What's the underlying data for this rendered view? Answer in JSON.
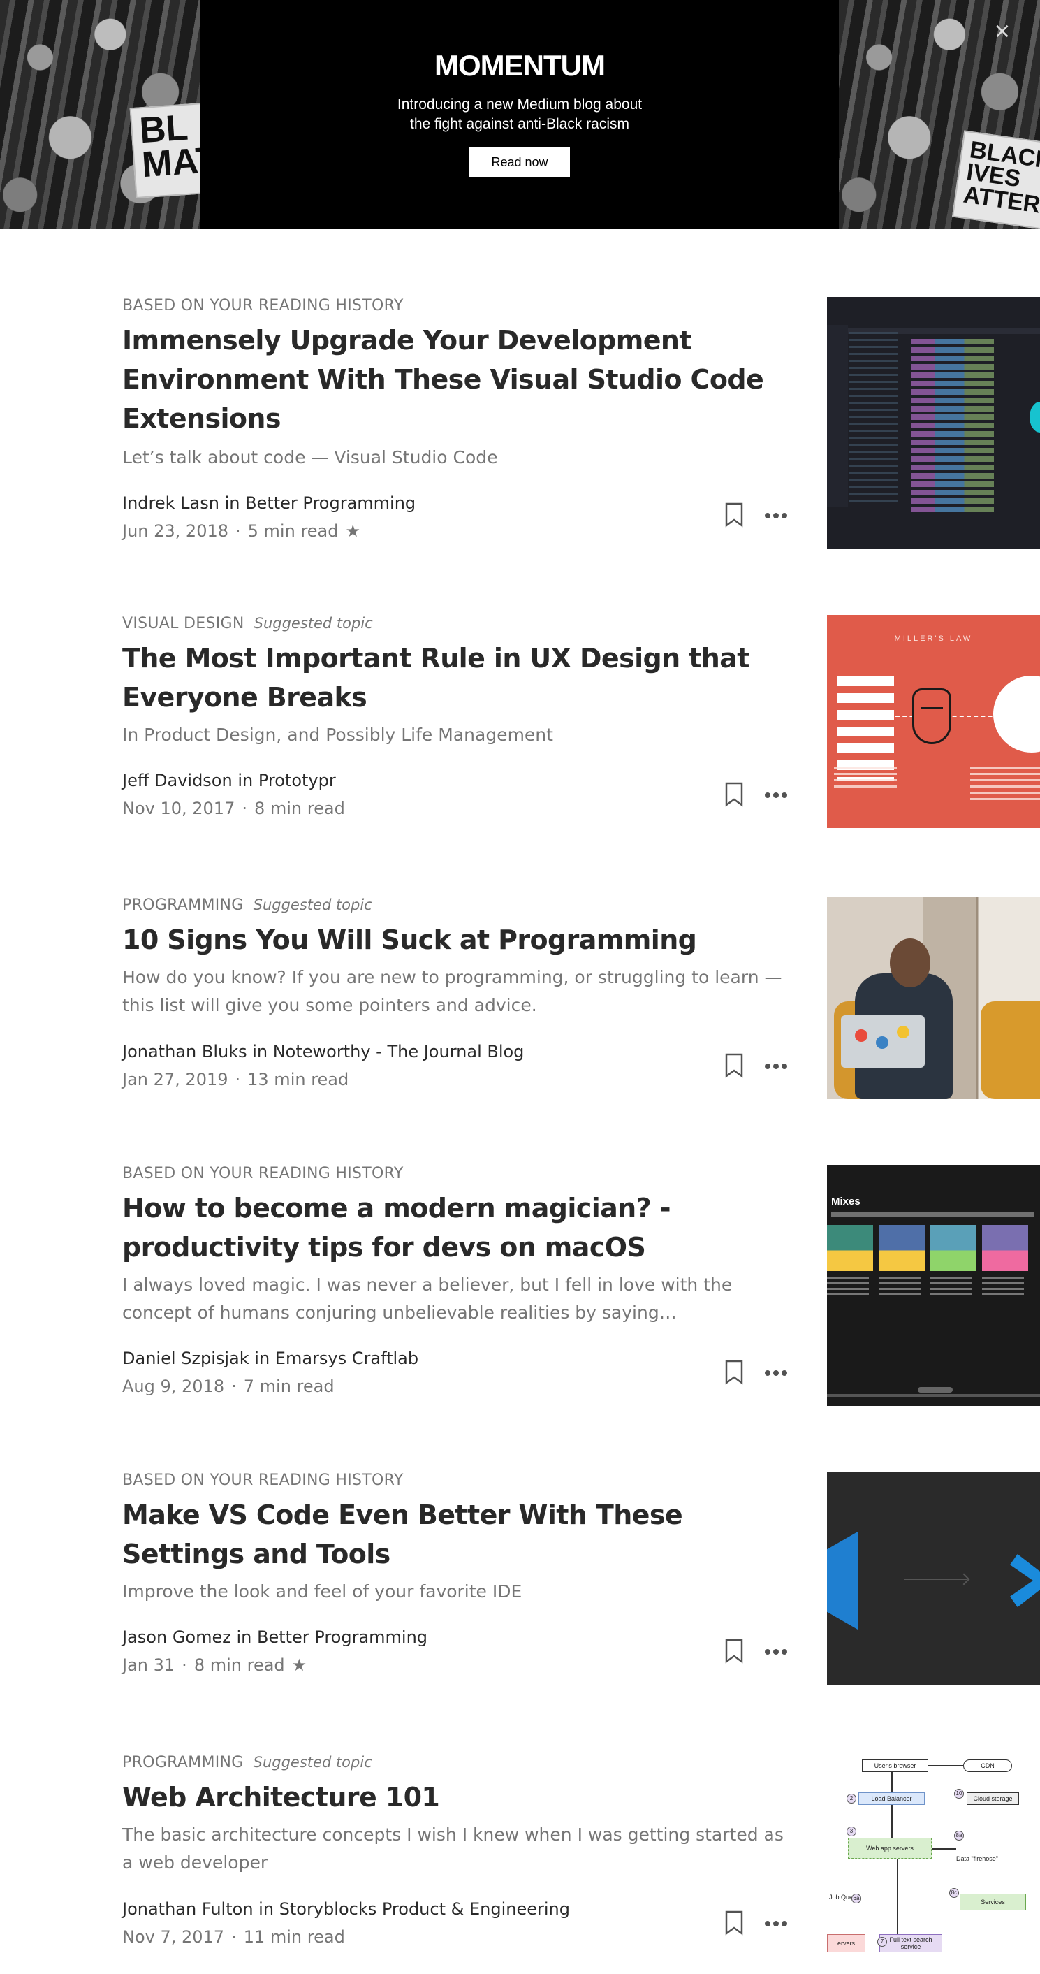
{
  "banner": {
    "logo": "MOMENTUM",
    "line1": "Introducing a new Medium blog about",
    "line2": "the fight against anti-Black racism",
    "button": "Read now",
    "close": "×",
    "left_sign": "BL\nMAT",
    "right_sign": "BLACK\nIVES\nATTER"
  },
  "icons": {
    "bookmark": "bookmark-icon",
    "more": "more-icon",
    "close": "close-icon"
  },
  "articles": [
    {
      "meta": "BASED ON YOUR READING HISTORY",
      "suggested": "",
      "title": "Immensely Upgrade Your Development Environment With These Visual Studio Code Extensions",
      "subtitle": "Let’s talk about code — Visual Studio Code",
      "author": "Indrek Lasn in Better Programming",
      "date": "Jun 23, 2018",
      "read_time": "5 min read",
      "star": "★"
    },
    {
      "meta": "VISUAL DESIGN",
      "suggested": "Suggested topic",
      "title": "The Most Important Rule in UX Design that Everyone Breaks",
      "subtitle": "In Product Design, and Possibly Life Management",
      "author": "Jeff Davidson in Prototypr",
      "date": "Nov 10, 2017",
      "read_time": "8 min read",
      "star": ""
    },
    {
      "meta": "PROGRAMMING",
      "suggested": "Suggested topic",
      "title": "10 Signs You Will Suck at Programming",
      "subtitle": "How do you know? If you are new to programming, or struggling to learn — this list will give you some pointers and advice.",
      "author": "Jonathan Bluks in Noteworthy - The Journal Blog",
      "date": "Jan 27, 2019",
      "read_time": "13 min read",
      "star": ""
    },
    {
      "meta": "BASED ON YOUR READING HISTORY",
      "suggested": "",
      "title": "How to become a modern magician? - productivity tips for devs on macOS",
      "subtitle": "I always loved magic. I was never a believer, but I fell in love with the concept of humans conjuring unbelievable realities by saying…",
      "author": "Daniel Szpisjak in Emarsys Craftlab",
      "date": "Aug 9, 2018",
      "read_time": "7 min read",
      "star": ""
    },
    {
      "meta": "BASED ON YOUR READING HISTORY",
      "suggested": "",
      "title": "Make VS Code Even Better With These Settings and Tools",
      "subtitle": "Improve the look and feel of your favorite IDE",
      "author": "Jason Gomez in Better Programming",
      "date": "Jan 31",
      "read_time": "8 min read",
      "star": "★"
    },
    {
      "meta": "PROGRAMMING",
      "suggested": "Suggested topic",
      "title": "Web Architecture 101",
      "subtitle": "The basic architecture concepts I wish I knew when I was getting started as a web developer",
      "author": "Jonathan Fulton in Storyblocks Product & Engineering",
      "date": "Nov 7, 2017",
      "read_time": "11 min read",
      "star": ""
    }
  ],
  "thumbs": {
    "millers_title": "MILLER'S LAW",
    "mixes_label": "Mixes",
    "diagram": {
      "users_browser": "User's browser",
      "cdn": "CDN",
      "load_balancer": "Load Balancer",
      "cloud_storage": "Cloud storage",
      "web_app_servers": "Web app servers",
      "data_firehose": "Data \"firehose\"",
      "job_queue": "Job Queue",
      "services": "Services",
      "full_text": "Full text search service",
      "servers": "ervers",
      "n1": "1",
      "n2": "2",
      "n3": "3",
      "n8a": "8a",
      "n8b": "8b",
      "n10": "10",
      "n6a": "6a",
      "n7": "7",
      "n8c": "8c"
    }
  }
}
